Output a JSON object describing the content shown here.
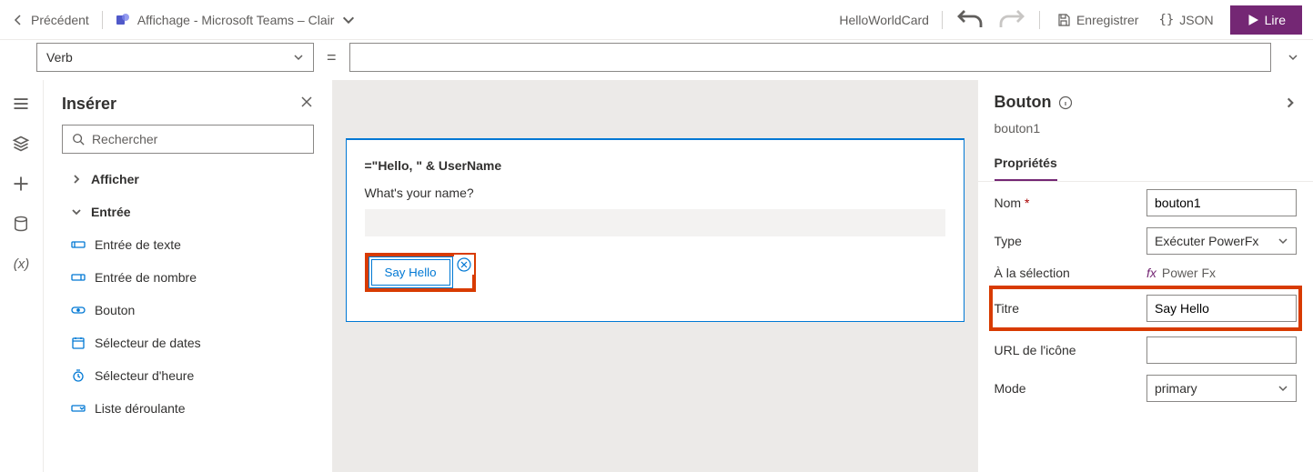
{
  "topbar": {
    "back_label": "Précédent",
    "theme_label": "Affichage - Microsoft Teams – Clair",
    "card_name": "HelloWorldCard",
    "save_label": "Enregistrer",
    "json_label": "JSON",
    "play_label": "Lire"
  },
  "formulabar": {
    "property": "Verb",
    "expression": ""
  },
  "insert": {
    "title": "Insérer",
    "search_placeholder": "Rechercher",
    "cat_display": "Afficher",
    "cat_input": "Entrée",
    "items": {
      "text_input": "Entrée de texte",
      "number_input": "Entrée de nombre",
      "button": "Bouton",
      "date_picker": "Sélecteur de dates",
      "time_picker": "Sélecteur d'heure",
      "dropdown": "Liste déroulante"
    }
  },
  "canvas": {
    "title_expr": "=\"Hello, \" & UserName",
    "question": "What's your name?",
    "button_label": "Say Hello"
  },
  "prop": {
    "heading": "Bouton",
    "control_name": "bouton1",
    "tab": "Propriétés",
    "rows": {
      "name_label": "Nom",
      "name_value": "bouton1",
      "type_label": "Type",
      "type_value": "Exécuter PowerFx",
      "onselect_label": "À la sélection",
      "onselect_value": "Power Fx",
      "title_label": "Titre",
      "title_value": "Say Hello",
      "iconurl_label": "URL de l'icône",
      "iconurl_value": "",
      "mode_label": "Mode",
      "mode_value": "primary"
    }
  }
}
